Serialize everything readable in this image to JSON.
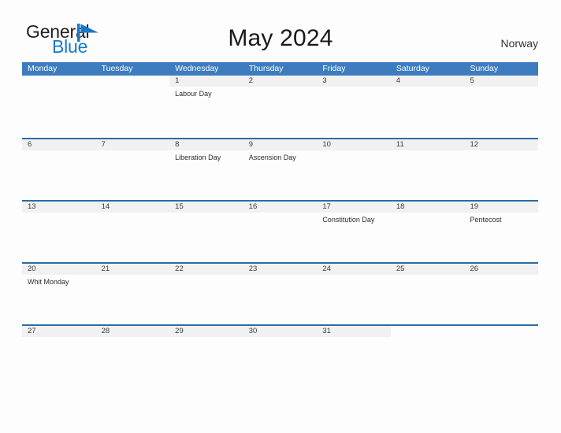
{
  "brand": {
    "name_part1": "General",
    "name_part2": "Blue",
    "flag_icon": "blue-flag-icon",
    "color_primary": "#1878c8",
    "color_text": "#221f20"
  },
  "header": {
    "title": "May 2024",
    "country": "Norway"
  },
  "calendar": {
    "header_bg": "#3d7cbe",
    "row_rule_color": "#2b6ca8",
    "date_band_bg": "#f1f1f1",
    "weekdays": [
      "Monday",
      "Tuesday",
      "Wednesday",
      "Thursday",
      "Friday",
      "Saturday",
      "Sunday"
    ],
    "weeks": [
      [
        {
          "day": "",
          "events": []
        },
        {
          "day": "",
          "events": []
        },
        {
          "day": "1",
          "events": [
            "Labour Day"
          ]
        },
        {
          "day": "2",
          "events": []
        },
        {
          "day": "3",
          "events": []
        },
        {
          "day": "4",
          "events": []
        },
        {
          "day": "5",
          "events": []
        }
      ],
      [
        {
          "day": "6",
          "events": []
        },
        {
          "day": "7",
          "events": []
        },
        {
          "day": "8",
          "events": [
            "Liberation Day"
          ]
        },
        {
          "day": "9",
          "events": [
            "Ascension Day"
          ]
        },
        {
          "day": "10",
          "events": []
        },
        {
          "day": "11",
          "events": []
        },
        {
          "day": "12",
          "events": []
        }
      ],
      [
        {
          "day": "13",
          "events": []
        },
        {
          "day": "14",
          "events": []
        },
        {
          "day": "15",
          "events": []
        },
        {
          "day": "16",
          "events": []
        },
        {
          "day": "17",
          "events": [
            "Constitution Day"
          ]
        },
        {
          "day": "18",
          "events": []
        },
        {
          "day": "19",
          "events": [
            "Pentecost"
          ]
        }
      ],
      [
        {
          "day": "20",
          "events": [
            "Whit Monday"
          ]
        },
        {
          "day": "21",
          "events": []
        },
        {
          "day": "22",
          "events": []
        },
        {
          "day": "23",
          "events": []
        },
        {
          "day": "24",
          "events": []
        },
        {
          "day": "25",
          "events": []
        },
        {
          "day": "26",
          "events": []
        }
      ],
      [
        {
          "day": "27",
          "events": []
        },
        {
          "day": "28",
          "events": []
        },
        {
          "day": "29",
          "events": []
        },
        {
          "day": "30",
          "events": []
        },
        {
          "day": "31",
          "events": []
        },
        {
          "day": "",
          "events": []
        },
        {
          "day": "",
          "events": []
        }
      ]
    ]
  }
}
